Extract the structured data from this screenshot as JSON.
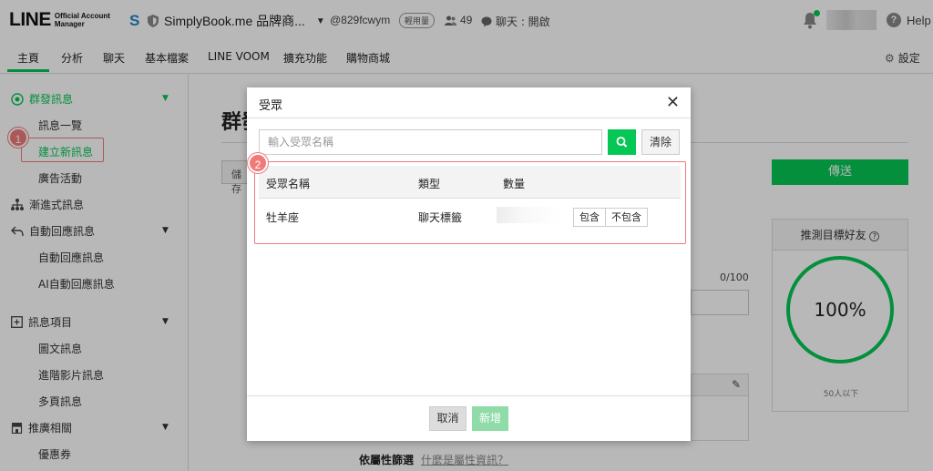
{
  "header": {
    "logo_main": "LINE",
    "logo_sub_line1": "Official Account",
    "logo_sub_line2": "Manager",
    "account_name": "SimplyBook.me 品牌商...",
    "account_id": "@829fcwym",
    "plan_badge": "輕用量",
    "friends_count": "49",
    "chat_status": "聊天 : 開啟",
    "help_label": "Help"
  },
  "nav": {
    "tabs": [
      "主頁",
      "分析",
      "聊天",
      "基本檔案",
      "LINE VOOM",
      "擴充功能",
      "購物商城"
    ],
    "settings_label": "設定"
  },
  "sidebar": {
    "broadcast_head": "群發訊息",
    "message_list": "訊息一覽",
    "create_new": "建立新訊息",
    "ad_campaign": "廣告活動",
    "step_message": "漸進式訊息",
    "auto_reply_head": "自動回應訊息",
    "auto_reply": "自動回應訊息",
    "ai_auto_reply": "AI自動回應訊息",
    "message_items_head": "訊息項目",
    "rich_message": "圖文訊息",
    "rich_video": "進階影片訊息",
    "card_message": "多頁訊息",
    "promo_head": "推廣相關",
    "coupon": "優惠券"
  },
  "annotations": {
    "step1": "1",
    "step2": "2"
  },
  "main": {
    "title": "群發",
    "save_label": "儲存",
    "send_label": "傳送",
    "target_title": "推測目標好友",
    "target_percent": "100%",
    "target_note": "50人以下",
    "counter": "0/100",
    "filter_label": "依屬性篩選",
    "filter_link": "什麼是屬性資訊？"
  },
  "modal": {
    "title": "受眾",
    "search_placeholder": "輸入受眾名稱",
    "clear_label": "清除",
    "columns": [
      "受眾名稱",
      "類型",
      "數量"
    ],
    "rows": [
      {
        "name": "牡羊座",
        "type": "聊天標籤",
        "include": "包含",
        "exclude": "不包含"
      }
    ],
    "cancel_label": "取消",
    "add_label": "新增"
  },
  "colors": {
    "accent": "#06c755",
    "annotation": "#f07a7a"
  }
}
